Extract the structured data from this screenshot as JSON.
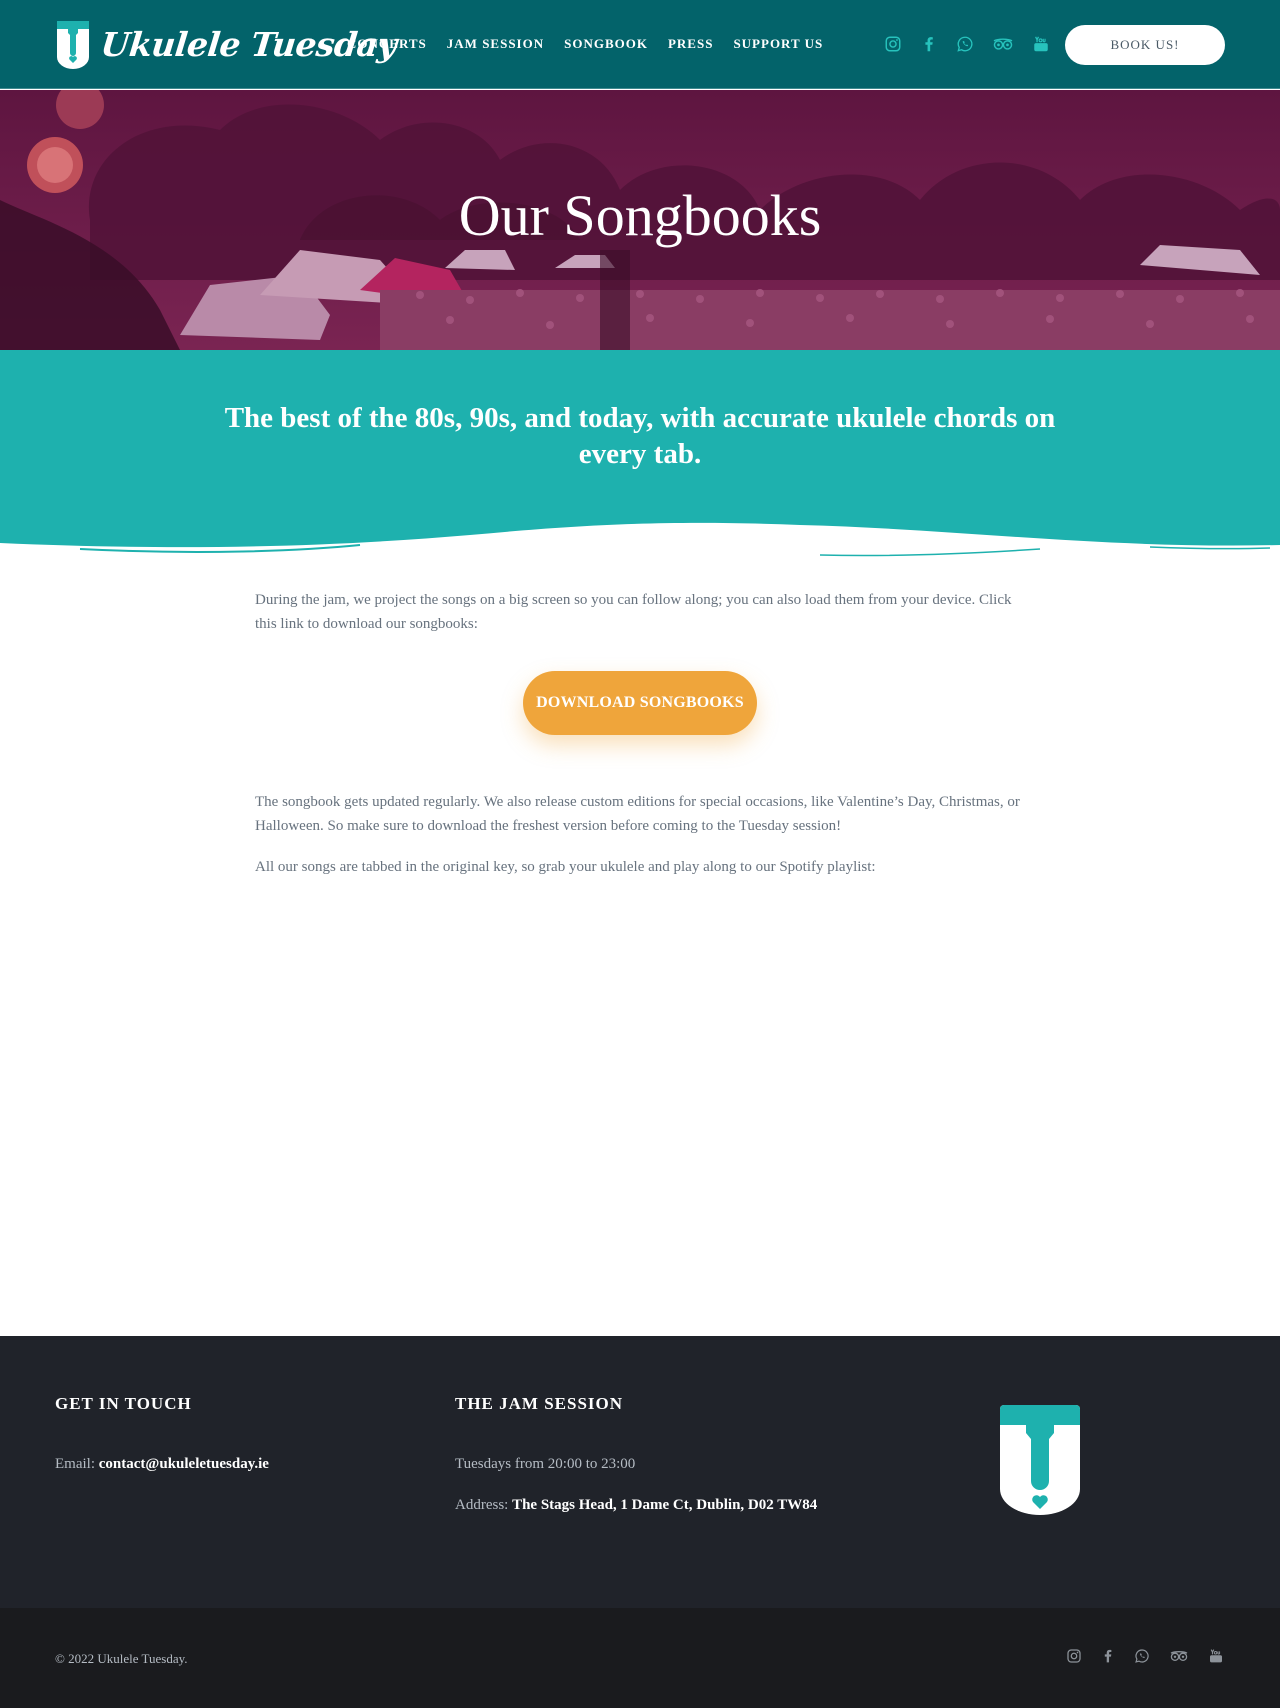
{
  "header": {
    "logo_text": "Ukulele Tuesday",
    "nav": [
      "CONCERTS",
      "JAM SESSION",
      "SONGBOOK",
      "PRESS",
      "SUPPORT US"
    ],
    "socials": [
      "instagram-icon",
      "facebook-icon",
      "whatsapp-icon",
      "tripadvisor-icon",
      "youtube-icon"
    ],
    "book_label": "BOOK US!"
  },
  "hero": {
    "title": "Our Songbooks"
  },
  "band": {
    "tagline": "The best of the 80s, 90s, and today, with accurate ukulele chords on every tab."
  },
  "content": {
    "intro": "During the jam, we project the songs on a big screen so you can follow along; you can also load them from your device. Click this link to download our songbooks:",
    "download_label": "DOWNLOAD SONGBOOKS",
    "updates": "The songbook gets updated regularly. We also release custom editions for  special occasions, like Valentine’s Day, Christmas, or Halloween. So make sure to download the freshest version before coming to the Tuesday session!",
    "spotify": "All our songs are tabbed in the original key, so grab your ukulele and play along to our Spotify playlist:"
  },
  "footer": {
    "contact_heading": "GET IN TOUCH",
    "email_label": "Email:",
    "email_value": "contact@ukuleletuesday.ie",
    "jam_heading": "THE JAM SESSION",
    "jam_time": "Tuesdays from 20:00 to 23:00",
    "address_label": "Address:",
    "address_value": "The Stags Head, 1 Dame Ct, Dublin, D02 TW84",
    "copyright": "© 2022 Ukulele Tuesday."
  },
  "colors": {
    "header_bg": "#03636a",
    "accent_teal": "#1eb1ae",
    "download_orange": "#efa53b",
    "hero_overlay": "#6a1a48",
    "footer_bg": "#20232a"
  }
}
